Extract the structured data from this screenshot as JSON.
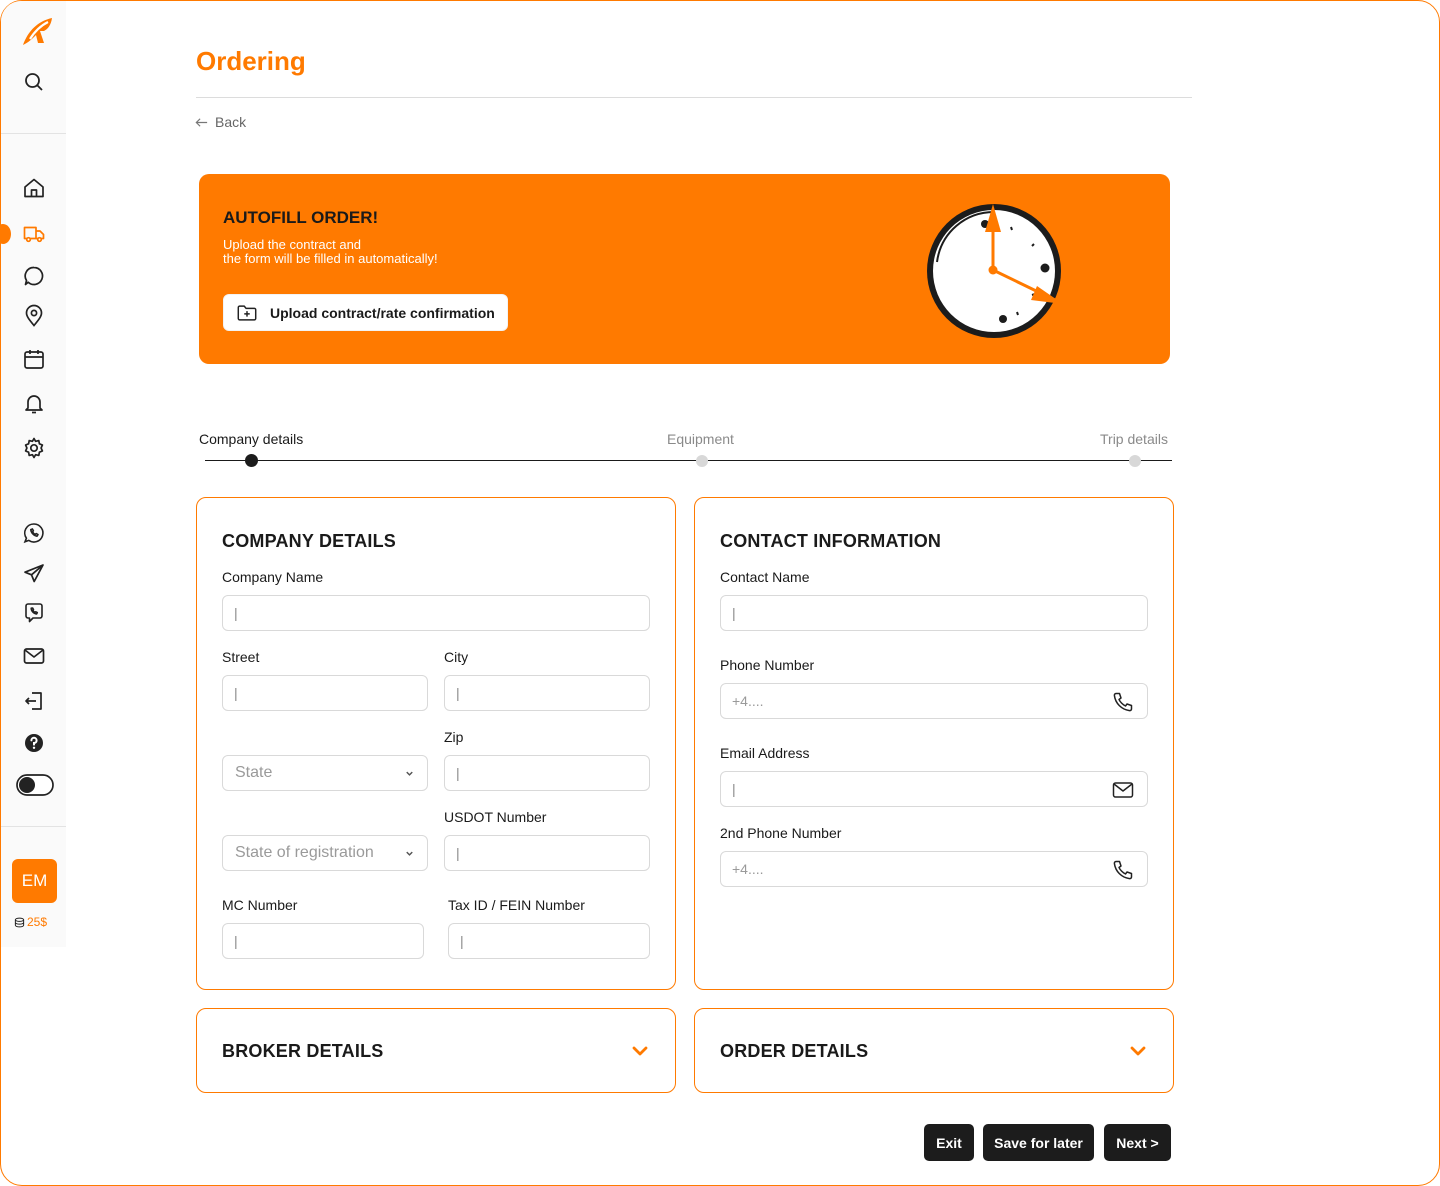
{
  "app": {
    "title": "Ordering",
    "back_label": "Back"
  },
  "colors": {
    "accent": "#ff7a00",
    "dark": "#1c1c1c"
  },
  "sidebar": {
    "icons": [
      "logo-icon",
      "search-icon",
      "home-icon",
      "truck-icon",
      "chat-icon",
      "location-pin-icon",
      "calendar-icon",
      "bell-icon",
      "settings-gear-icon",
      "whatsapp-icon",
      "telegram-icon",
      "viber-icon",
      "mail-icon",
      "logout-icon",
      "help-icon",
      "theme-toggle"
    ],
    "avatar": "EM",
    "credits": "25$"
  },
  "banner": {
    "title": "AUTOFILL ORDER!",
    "line1": "Upload the contract and",
    "line2": "the form will be filled in automatically!",
    "upload_label": "Upload contract/rate confirmation"
  },
  "stepper": {
    "steps": [
      "Company details",
      "Equipment",
      "Trip details"
    ],
    "active_step": 0
  },
  "company": {
    "title": "COMPANY DETAILS",
    "company_name_label": "Company Name",
    "street_label": "Street",
    "city_label": "City",
    "zip_label": "Zip",
    "state_placeholder": "State",
    "usdot_label": "USDOT Number",
    "state_reg_placeholder": "State of registration",
    "mc_label": "MC Number",
    "tax_label": "Tax ID / FEIN Number",
    "caret": "|"
  },
  "contact": {
    "title": "CONTACT INFORMATION",
    "contact_name_label": "Contact Name",
    "phone_label": "Phone Number",
    "phone_placeholder": "+4....",
    "email_label": "Email Address",
    "phone2_label": "2nd Phone Number",
    "phone2_placeholder": "+4....",
    "caret": "|"
  },
  "broker": {
    "title": "BROKER DETAILS"
  },
  "order": {
    "title": "ORDER DETAILS"
  },
  "footer": {
    "exit_label": "Exit",
    "save_label": "Save for later",
    "next_label": "Next >"
  }
}
